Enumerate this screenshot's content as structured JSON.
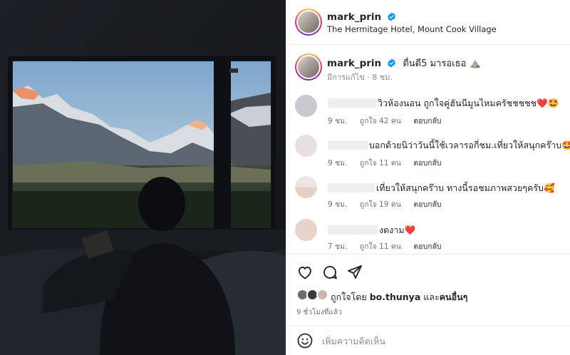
{
  "post": {
    "author": {
      "username": "mark_prin",
      "verified": true,
      "location": "The Hermitage Hotel, Mount Cook Village"
    },
    "caption": {
      "username": "mark_prin",
      "text": "ตื่นดี5 มารอเธอ ⛰️",
      "edited_label": "มีการแก้ไข",
      "time": "8 ชม."
    },
    "comments": [
      {
        "text": "วิวห้องนอน ถูกใจคู่ฮันนีมูนไหมครัชชชชช❤️🤩",
        "time": "9 ชม.",
        "likes": "ถูกใจ 42 คน",
        "reply": "ตอบกลับ",
        "avatar_color": "#c9c9cf"
      },
      {
        "text": "บอกด้วยนิว่าวันนี้ใช้เวลารอกี่ชม.เที่ยวให้สนุกคร๊าบ🤩",
        "time": "9 ชม.",
        "likes": "ถูกใจ 11 คน",
        "reply": "ตอบกลับ",
        "avatar_color": "#e7dfe2"
      },
      {
        "text": "เที่ยวให้สนุกคร๊าบ ทางนี้รอชมภาพสวยๆครับ🥰",
        "time": "9 ชม.",
        "likes": "ถูกใจ 19 คน",
        "reply": "ตอบกลับ",
        "avatar_color": "#e9d7cf"
      },
      {
        "text": "งดงาม❤️",
        "time": "7 ชม.",
        "likes": "ถูกใจ 11 คน",
        "reply": "ตอบกลับ",
        "avatar_color": "#e8d3cb"
      }
    ],
    "likes": {
      "prefix": "ถูกใจโดย",
      "user": "bo.thunya",
      "and": "และ",
      "others": "คนอื่นๆ"
    },
    "time_ago": "9 ชั่วโมงที่แล้ว",
    "add_comment_placeholder": "เพิ่มความคิดเห็น"
  },
  "icons": {
    "verified": "verified-badge-icon",
    "like": "heart-icon",
    "comment": "comment-bubble-icon",
    "share": "paper-plane-icon",
    "emoji": "smiley-icon"
  },
  "colors": {
    "verified_blue": "#0095f6",
    "heart_red": "#ed4956",
    "muted_text": "#737373",
    "divider": "#efefef"
  }
}
